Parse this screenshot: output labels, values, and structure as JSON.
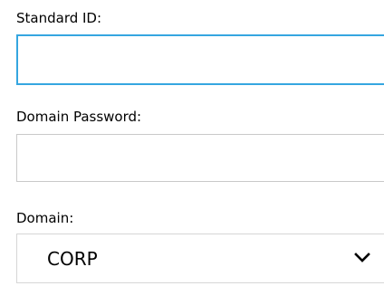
{
  "form": {
    "standard_id": {
      "label": "Standard ID:",
      "value": "",
      "placeholder": ""
    },
    "domain_password": {
      "label": "Domain Password:",
      "value": "",
      "placeholder": ""
    },
    "domain": {
      "label": "Domain:",
      "selected": "CORP",
      "icon": "chevron-down-icon"
    }
  },
  "colors": {
    "focus_border": "#35a6e0",
    "input_border": "#c9c9c9",
    "select_border": "#d6d6d6"
  }
}
